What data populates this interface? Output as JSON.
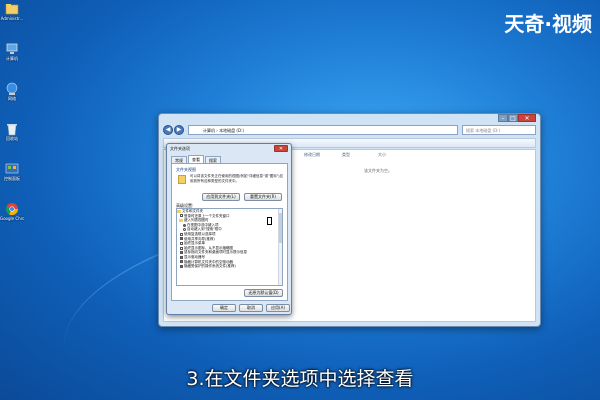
{
  "watermark": {
    "logo_text": "天奇·视频"
  },
  "caption": "3.在文件夹选项中选择查看",
  "desktop_icons": [
    {
      "label": "Administr...",
      "icon": "user-folder-icon"
    },
    {
      "label": "计算机",
      "icon": "computer-icon"
    },
    {
      "label": "网络",
      "icon": "network-icon"
    },
    {
      "label": "回收站",
      "icon": "recycle-bin-icon"
    },
    {
      "label": "控制面板",
      "icon": "control-panel-icon"
    },
    {
      "label": "Google Chrome",
      "icon": "chrome-icon"
    }
  ],
  "explorer": {
    "address": "计算机 › 本地磁盘 (D:)",
    "search_placeholder": "搜索 本地磁盘 (D:)",
    "columns": [
      "修改日期",
      "类型",
      "大小"
    ],
    "empty_message": "该文件夹为空。"
  },
  "dialog": {
    "title": "文件夹选项",
    "tabs": [
      "常规",
      "查看",
      "搜索"
    ],
    "active_tab": "查看",
    "folder_views_label": "文件夹视图",
    "folder_views_desc": "可以将该文件夹正在使用的视图(例如\"详细信息\"或\"图标\")应用到所有这种类型的文件夹中。",
    "apply_to_folders": "应用到文件夹(L)",
    "reset_folders": "重置文件夹(R)",
    "advanced_label": "高级设置:",
    "advanced_items": [
      {
        "text": "文件和文件夹",
        "kind": "folder"
      },
      {
        "text": "登录时还原上一个文件夹窗口",
        "kind": "check",
        "checked": false
      },
      {
        "text": "键入列表视图时",
        "kind": "folder"
      },
      {
        "text": "在视图中选中键入项",
        "kind": "radio",
        "checked": true
      },
      {
        "text": "自动键入到\"搜索\"框中",
        "kind": "radio",
        "checked": false
      },
      {
        "text": "使用复选框以选择项",
        "kind": "check",
        "checked": false
      },
      {
        "text": "使用共享向导(推荐)",
        "kind": "check",
        "checked": true
      },
      {
        "text": "始终显示菜单",
        "kind": "check",
        "checked": false
      },
      {
        "text": "始终显示图标，从不显示缩略图",
        "kind": "check",
        "checked": false
      },
      {
        "text": "鼠标指向文件夹和桌面项时显示提示信息",
        "kind": "check",
        "checked": true
      },
      {
        "text": "显示驱动器号",
        "kind": "check",
        "checked": true
      },
      {
        "text": "隐藏计算机文件夹中的空驱动器",
        "kind": "check",
        "checked": true
      },
      {
        "text": "隐藏受保护的操作系统文件(推荐)",
        "kind": "check",
        "checked": true
      }
    ],
    "restore_defaults": "还原为默认值(D)",
    "ok": "确定",
    "cancel": "取消",
    "apply": "应用(A)"
  }
}
